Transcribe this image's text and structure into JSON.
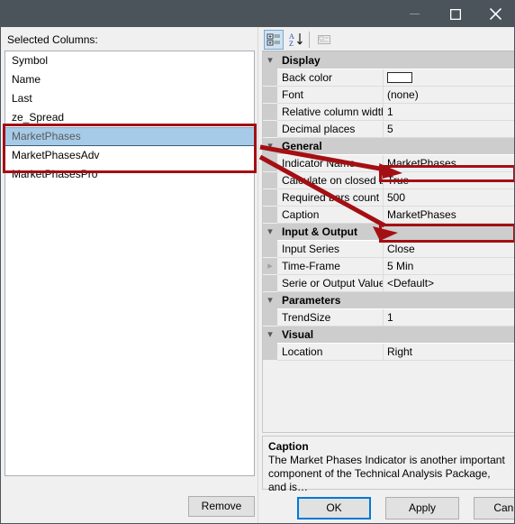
{
  "window": {
    "title": "",
    "controls": {
      "minimize": "minimize-icon",
      "maximize": "maximize-icon",
      "close": "close-icon"
    }
  },
  "left_panel": {
    "label": "Selected Columns:",
    "columns": [
      {
        "name": "Symbol",
        "selected": false
      },
      {
        "name": "Name",
        "selected": false
      },
      {
        "name": "Last",
        "selected": false
      },
      {
        "name": "ze_Spread",
        "selected": false
      },
      {
        "name": "MarketPhases",
        "selected": true
      },
      {
        "name": "MarketPhasesAdv",
        "selected": false
      },
      {
        "name": "MarketPhasesPro",
        "selected": false
      }
    ],
    "remove_button": "Remove"
  },
  "property_grid": {
    "toolbar": {
      "categorized": "categorized-view-icon",
      "alphabetical": "alphabetical-sort-icon",
      "property_pages": "property-pages-icon"
    },
    "categories": [
      {
        "name": "Display",
        "expanded": true,
        "rows": [
          {
            "label": "Back color",
            "value": "",
            "kind": "color",
            "color": "#ffffff"
          },
          {
            "label": "Font",
            "value": "(none)",
            "kind": "text"
          },
          {
            "label": "Relative column width",
            "value": "1",
            "kind": "text"
          },
          {
            "label": "Decimal places",
            "value": "5",
            "kind": "text"
          }
        ]
      },
      {
        "name": "General",
        "expanded": true,
        "rows": [
          {
            "label": "Indicator Name",
            "value": "MarketPhases",
            "kind": "text"
          },
          {
            "label": "Calculate on closed b",
            "value": "True",
            "kind": "text"
          },
          {
            "label": "Required bars count",
            "value": "500",
            "kind": "text",
            "highlighted": true
          },
          {
            "label": "Caption",
            "value": "MarketPhases",
            "kind": "text"
          }
        ]
      },
      {
        "name": "Input & Output",
        "expanded": true,
        "rows": [
          {
            "label": "Input Series",
            "value": "Close",
            "kind": "text"
          },
          {
            "label": "Time-Frame",
            "value": "5 Min",
            "kind": "text",
            "expandable": true,
            "highlighted": true
          },
          {
            "label": "Serie or Output Value",
            "value": "<Default>",
            "kind": "text"
          }
        ]
      },
      {
        "name": "Parameters",
        "expanded": true,
        "rows": [
          {
            "label": "TrendSize",
            "value": "1",
            "kind": "text"
          }
        ]
      },
      {
        "name": "Visual",
        "expanded": true,
        "rows": [
          {
            "label": "Location",
            "value": "Right",
            "kind": "text"
          }
        ]
      }
    ]
  },
  "help": {
    "title": "Caption",
    "text": "The Market Phases Indicator is another important component of the Technical Analysis Package, and is…"
  },
  "buttons": {
    "ok": "OK",
    "apply": "Apply",
    "cancel": "Cancel"
  },
  "annotations": {
    "color": "#a40f14",
    "boxes": [
      "selected-columns-group",
      "required-bars-count-value",
      "time-frame-value"
    ],
    "arrows": 2
  },
  "colors": {
    "titlebar": "#4b545b",
    "selection": "#a6cbe8",
    "focus": "#0078d7",
    "annotation": "#a40f14"
  }
}
